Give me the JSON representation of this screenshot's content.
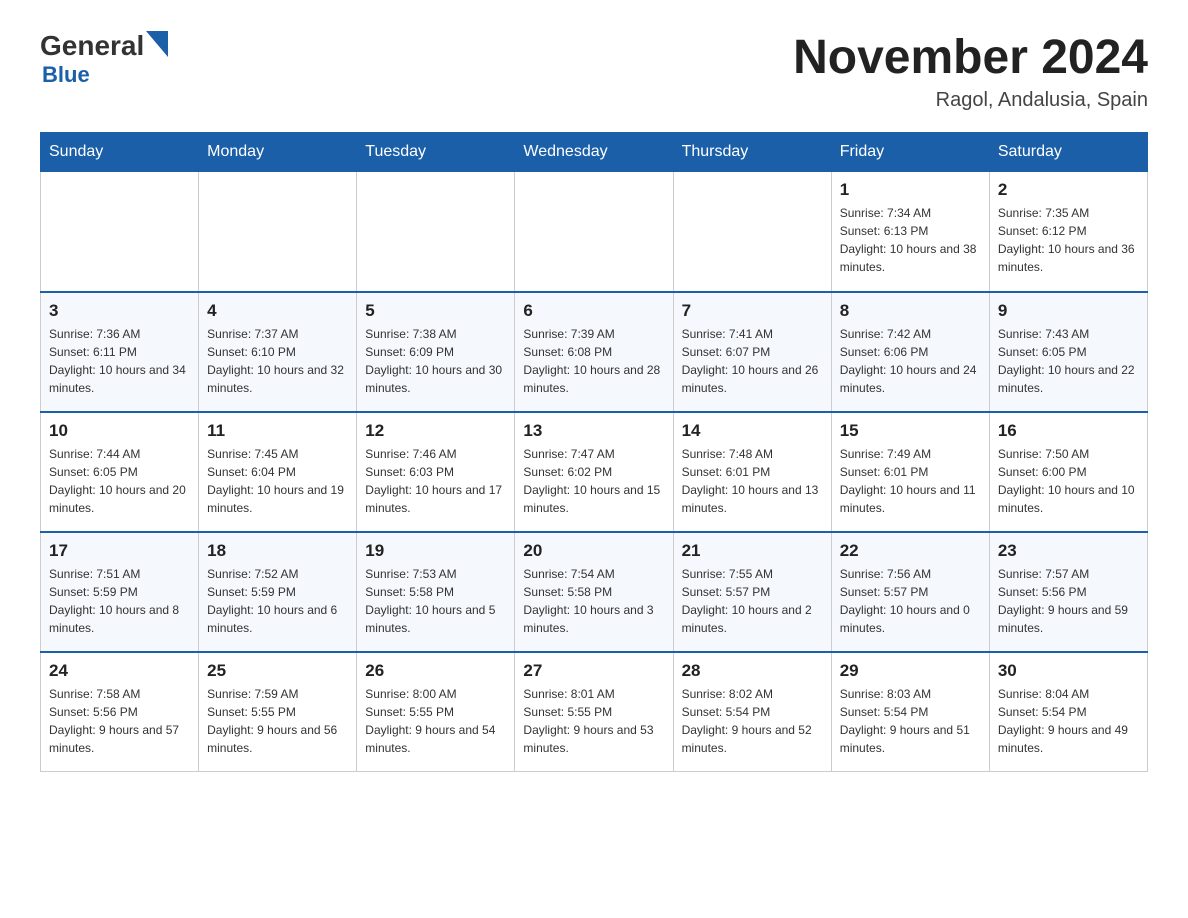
{
  "logo": {
    "text_general": "General",
    "text_blue": "Blue",
    "triangle_char": "▶"
  },
  "title": {
    "month_year": "November 2024",
    "location": "Ragol, Andalusia, Spain"
  },
  "weekdays": [
    "Sunday",
    "Monday",
    "Tuesday",
    "Wednesday",
    "Thursday",
    "Friday",
    "Saturday"
  ],
  "weeks": [
    [
      {
        "day": "",
        "info": ""
      },
      {
        "day": "",
        "info": ""
      },
      {
        "day": "",
        "info": ""
      },
      {
        "day": "",
        "info": ""
      },
      {
        "day": "",
        "info": ""
      },
      {
        "day": "1",
        "info": "Sunrise: 7:34 AM\nSunset: 6:13 PM\nDaylight: 10 hours and 38 minutes."
      },
      {
        "day": "2",
        "info": "Sunrise: 7:35 AM\nSunset: 6:12 PM\nDaylight: 10 hours and 36 minutes."
      }
    ],
    [
      {
        "day": "3",
        "info": "Sunrise: 7:36 AM\nSunset: 6:11 PM\nDaylight: 10 hours and 34 minutes."
      },
      {
        "day": "4",
        "info": "Sunrise: 7:37 AM\nSunset: 6:10 PM\nDaylight: 10 hours and 32 minutes."
      },
      {
        "day": "5",
        "info": "Sunrise: 7:38 AM\nSunset: 6:09 PM\nDaylight: 10 hours and 30 minutes."
      },
      {
        "day": "6",
        "info": "Sunrise: 7:39 AM\nSunset: 6:08 PM\nDaylight: 10 hours and 28 minutes."
      },
      {
        "day": "7",
        "info": "Sunrise: 7:41 AM\nSunset: 6:07 PM\nDaylight: 10 hours and 26 minutes."
      },
      {
        "day": "8",
        "info": "Sunrise: 7:42 AM\nSunset: 6:06 PM\nDaylight: 10 hours and 24 minutes."
      },
      {
        "day": "9",
        "info": "Sunrise: 7:43 AM\nSunset: 6:05 PM\nDaylight: 10 hours and 22 minutes."
      }
    ],
    [
      {
        "day": "10",
        "info": "Sunrise: 7:44 AM\nSunset: 6:05 PM\nDaylight: 10 hours and 20 minutes."
      },
      {
        "day": "11",
        "info": "Sunrise: 7:45 AM\nSunset: 6:04 PM\nDaylight: 10 hours and 19 minutes."
      },
      {
        "day": "12",
        "info": "Sunrise: 7:46 AM\nSunset: 6:03 PM\nDaylight: 10 hours and 17 minutes."
      },
      {
        "day": "13",
        "info": "Sunrise: 7:47 AM\nSunset: 6:02 PM\nDaylight: 10 hours and 15 minutes."
      },
      {
        "day": "14",
        "info": "Sunrise: 7:48 AM\nSunset: 6:01 PM\nDaylight: 10 hours and 13 minutes."
      },
      {
        "day": "15",
        "info": "Sunrise: 7:49 AM\nSunset: 6:01 PM\nDaylight: 10 hours and 11 minutes."
      },
      {
        "day": "16",
        "info": "Sunrise: 7:50 AM\nSunset: 6:00 PM\nDaylight: 10 hours and 10 minutes."
      }
    ],
    [
      {
        "day": "17",
        "info": "Sunrise: 7:51 AM\nSunset: 5:59 PM\nDaylight: 10 hours and 8 minutes."
      },
      {
        "day": "18",
        "info": "Sunrise: 7:52 AM\nSunset: 5:59 PM\nDaylight: 10 hours and 6 minutes."
      },
      {
        "day": "19",
        "info": "Sunrise: 7:53 AM\nSunset: 5:58 PM\nDaylight: 10 hours and 5 minutes."
      },
      {
        "day": "20",
        "info": "Sunrise: 7:54 AM\nSunset: 5:58 PM\nDaylight: 10 hours and 3 minutes."
      },
      {
        "day": "21",
        "info": "Sunrise: 7:55 AM\nSunset: 5:57 PM\nDaylight: 10 hours and 2 minutes."
      },
      {
        "day": "22",
        "info": "Sunrise: 7:56 AM\nSunset: 5:57 PM\nDaylight: 10 hours and 0 minutes."
      },
      {
        "day": "23",
        "info": "Sunrise: 7:57 AM\nSunset: 5:56 PM\nDaylight: 9 hours and 59 minutes."
      }
    ],
    [
      {
        "day": "24",
        "info": "Sunrise: 7:58 AM\nSunset: 5:56 PM\nDaylight: 9 hours and 57 minutes."
      },
      {
        "day": "25",
        "info": "Sunrise: 7:59 AM\nSunset: 5:55 PM\nDaylight: 9 hours and 56 minutes."
      },
      {
        "day": "26",
        "info": "Sunrise: 8:00 AM\nSunset: 5:55 PM\nDaylight: 9 hours and 54 minutes."
      },
      {
        "day": "27",
        "info": "Sunrise: 8:01 AM\nSunset: 5:55 PM\nDaylight: 9 hours and 53 minutes."
      },
      {
        "day": "28",
        "info": "Sunrise: 8:02 AM\nSunset: 5:54 PM\nDaylight: 9 hours and 52 minutes."
      },
      {
        "day": "29",
        "info": "Sunrise: 8:03 AM\nSunset: 5:54 PM\nDaylight: 9 hours and 51 minutes."
      },
      {
        "day": "30",
        "info": "Sunrise: 8:04 AM\nSunset: 5:54 PM\nDaylight: 9 hours and 49 minutes."
      }
    ]
  ]
}
